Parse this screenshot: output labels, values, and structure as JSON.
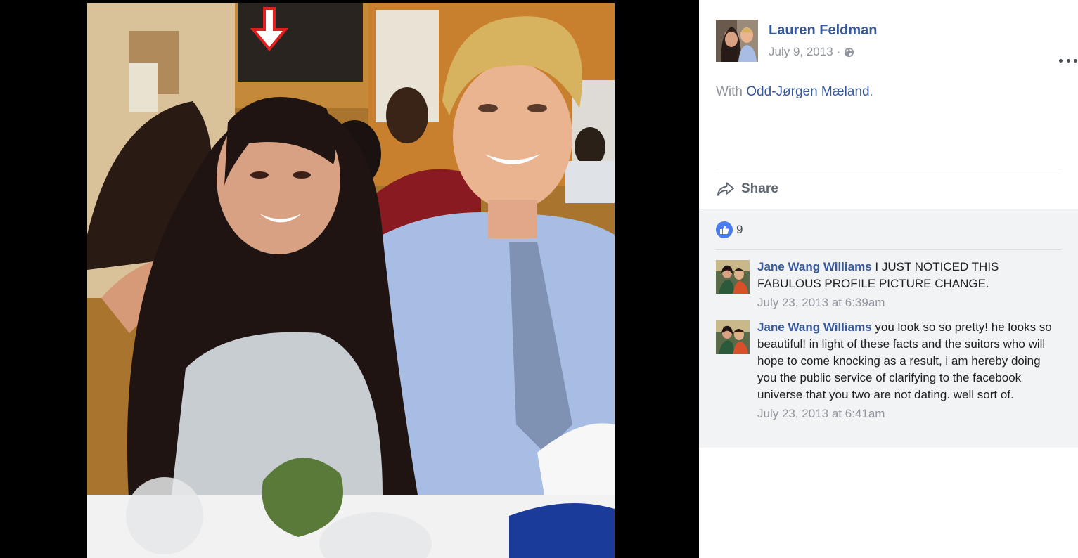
{
  "post": {
    "author": "Lauren Feldman",
    "date": "July 9, 2013",
    "separator": "·",
    "privacy_icon": "globe-icon",
    "with_prefix": "With",
    "tagged_name": "Odd-Jørgen Mæland",
    "with_suffix": "."
  },
  "actions": {
    "share_label": "Share"
  },
  "reactions": {
    "icon": "like-icon",
    "count": "9"
  },
  "comments": [
    {
      "author": "Jane Wang Williams",
      "text": "I JUST NOTICED THIS FABULOUS PROFILE PICTURE CHANGE.",
      "time": "July 23, 2013 at 6:39am"
    },
    {
      "author": "Jane Wang Williams",
      "text": "you look so so pretty! he looks so beautiful! in light of these facts and the suitors who will hope to come knocking as a result, i am hereby doing you the public service of clarifying to the facebook universe that you two are not dating. well sort of.",
      "time": "July 23, 2013 at 6:41am"
    }
  ],
  "colors": {
    "link": "#365899",
    "meta": "#90949c",
    "like": "#4a7cf0",
    "annotation_arrow": "#e02020"
  }
}
